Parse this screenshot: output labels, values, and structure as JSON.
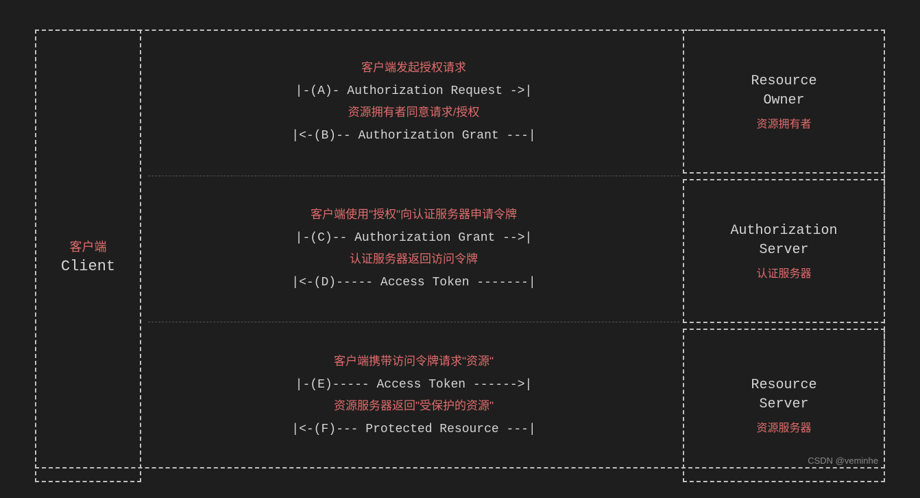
{
  "diagram": {
    "background": "#1e1e1e",
    "client": {
      "label_cn": "客户端",
      "label_en": "Client"
    },
    "resource_owner": {
      "label_en_line1": "Resource",
      "label_en_line2": "Owner",
      "label_cn": "资源拥有者"
    },
    "auth_server": {
      "label_en_line1": "Authorization",
      "label_en_line2": "Server",
      "label_cn": "认证服务器"
    },
    "resource_server": {
      "label_en_line1": "Resource",
      "label_en_line2": "Server",
      "label_cn": "资源服务器"
    },
    "section1": {
      "annotation_top": "客户端发起授权请求",
      "flow_a": "|-(A)- Authorization Request ->|",
      "annotation_mid": "资源拥有者同意请求/授权",
      "flow_b": "|<-(B)-- Authorization Grant ---|"
    },
    "section2": {
      "annotation_top": "客户端使用\"授权\"向认证服务器申请令牌",
      "flow_c": "|-(C)-- Authorization Grant -->|",
      "annotation_mid": "认证服务器返回访问令牌",
      "flow_d": "|<-(D)----- Access Token -------|"
    },
    "section3": {
      "annotation_top": "客户端携带访问令牌请求\"资源\"",
      "flow_e": "|-(E)----- Access Token ------->|",
      "annotation_mid": "资源服务器返回\"受保护的资源\"",
      "flow_f": "|<-(F)--- Protected Resource ---|"
    },
    "watermark": "CSDN @veminhe"
  }
}
